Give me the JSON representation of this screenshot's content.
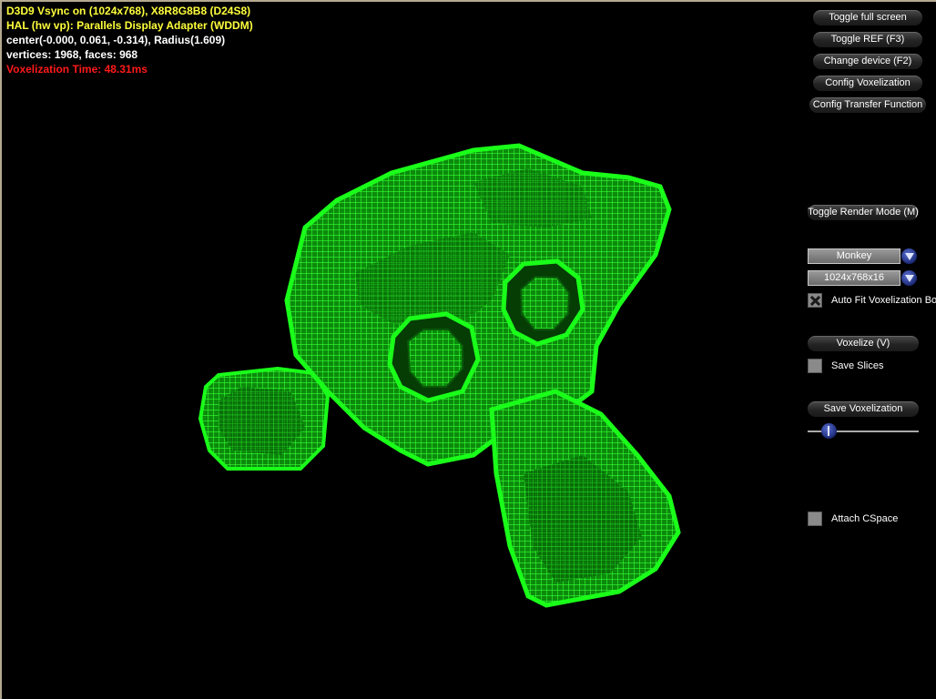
{
  "stats": {
    "line1": "D3D9 Vsync on (1024x768), X8R8G8B8 (D24S8)",
    "line2": "HAL (hw vp): Parallels Display Adapter (WDDM)",
    "line3": "center(-0.000, 0.061, -0.314), Radius(1.609)",
    "line4": "vertices: 1968, faces: 968",
    "line5": "Voxelization Time: 48.31ms"
  },
  "colors": {
    "stats_yellow": "#ffff3c",
    "stats_white": "#ffffff",
    "stats_red": "#ff1a1a",
    "voxel_green": "#1aff1a",
    "background": "#000000"
  },
  "buttons": {
    "toggle_full_screen": "Toggle full screen",
    "toggle_ref": "Toggle REF (F3)",
    "change_device": "Change device (F2)",
    "config_voxelization": "Config Voxelization",
    "config_transfer_function": "Config Transfer Function",
    "toggle_render_mode": "Toggle Render Mode (M)",
    "voxelize": "Voxelize (V)",
    "save_voxelization": "Save Voxelization"
  },
  "controls": {
    "model_select": "Monkey",
    "resolution_select": "1024x768x16",
    "auto_fit_label": "Auto Fit Voxelization Bo",
    "auto_fit_checked": true,
    "save_slices_label": "Save Slices",
    "save_slices_checked": false,
    "attach_cspace_label": "Attach CSpace",
    "attach_cspace_checked": false,
    "slider_fraction": 0.19
  },
  "icons": {
    "dropdown": "chevron-down-icon",
    "check": "x-check-icon"
  }
}
